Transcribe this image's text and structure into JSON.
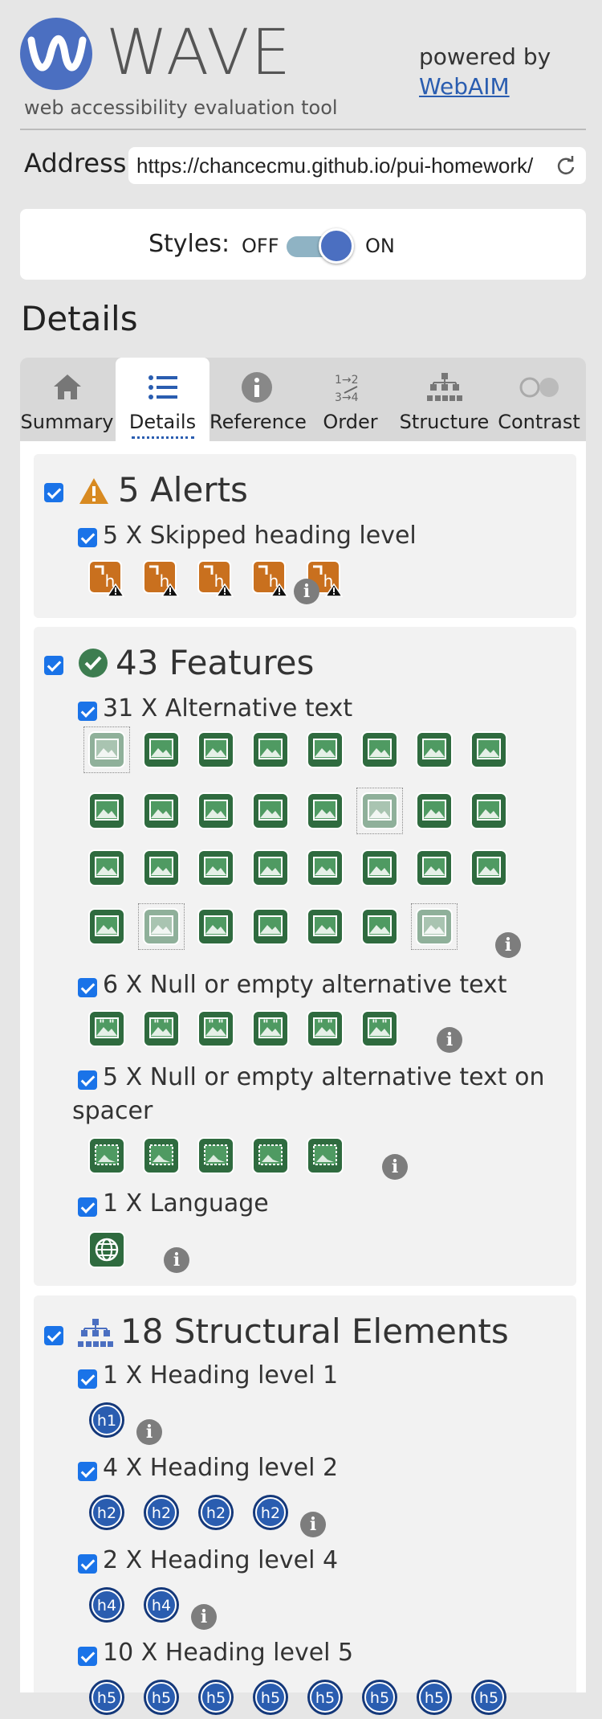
{
  "header": {
    "logo_text": "WAVE",
    "tagline": "web accessibility evaluation tool",
    "powered_by": "powered by",
    "webaim_link": "WebAIM"
  },
  "address": {
    "label": "Address:",
    "value": "https://chancecmu.github.io/pui-homework/"
  },
  "styles": {
    "label": "Styles:",
    "off": "OFF",
    "on": "ON",
    "state": "on"
  },
  "page_title": "Details",
  "tabs": [
    {
      "label": "Summary",
      "icon": "home-icon"
    },
    {
      "label": "Details",
      "icon": "list-icon",
      "active": true
    },
    {
      "label": "Reference",
      "icon": "info-icon"
    },
    {
      "label": "Order",
      "icon": "order-icon"
    },
    {
      "label": "Structure",
      "icon": "structure-icon"
    },
    {
      "label": "Contrast",
      "icon": "contrast-icon"
    }
  ],
  "alerts": {
    "title": "5 Alerts",
    "items": [
      {
        "title": "5 X Skipped heading level",
        "count": 5
      }
    ]
  },
  "features": {
    "title": "43 Features",
    "items": [
      {
        "title": "31 X Alternative text",
        "count": 31
      },
      {
        "title": "6 X Null or empty alternative text",
        "count": 6
      },
      {
        "title_line1": "5 X Null or empty alternative text on",
        "title_line2": "spacer",
        "count": 5
      },
      {
        "title": "1 X Language",
        "count": 1
      }
    ]
  },
  "structure": {
    "title": "18 Structural Elements",
    "items": [
      {
        "title": "1 X Heading level 1",
        "badge": "h1",
        "count": 1
      },
      {
        "title": "4 X Heading level 2",
        "badge": "h2",
        "count": 4
      },
      {
        "title": "2 X Heading level 4",
        "badge": "h4",
        "count": 2
      },
      {
        "title": "10 X Heading level 5",
        "badge": "h5",
        "count": 10
      }
    ]
  },
  "info_glyph": "i",
  "colors": {
    "brand": "#4b6fc1",
    "feature_green": "#2f6b3f",
    "alert_orange": "#c9701e",
    "heading_blue": "#1f4f99"
  }
}
